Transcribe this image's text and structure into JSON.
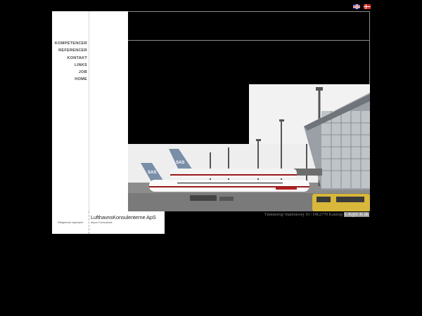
{
  "languages": [
    {
      "name": "english",
      "icon": "uk-flag-icon"
    },
    {
      "name": "danish",
      "icon": "denmark-flag-icon"
    }
  ],
  "menu": {
    "items": [
      "KOMPETENCER",
      "REFERENCER",
      "KONTAKT",
      "LINKS",
      "JOB",
      "HOME"
    ]
  },
  "footer": {
    "company_name": "LufthavnsKonsulenterne ApS",
    "tagline_left": "Rådgivende Ingeniører",
    "tagline_right": "Airport Consultants",
    "address": "Tømmerup Stationsvej 10 / DK2770 Kastrup",
    "email": "L-K@L-K.dk"
  },
  "colors": {
    "background": "#000000",
    "panel": "#ffffff",
    "frame_line": "#8a8a8a"
  }
}
